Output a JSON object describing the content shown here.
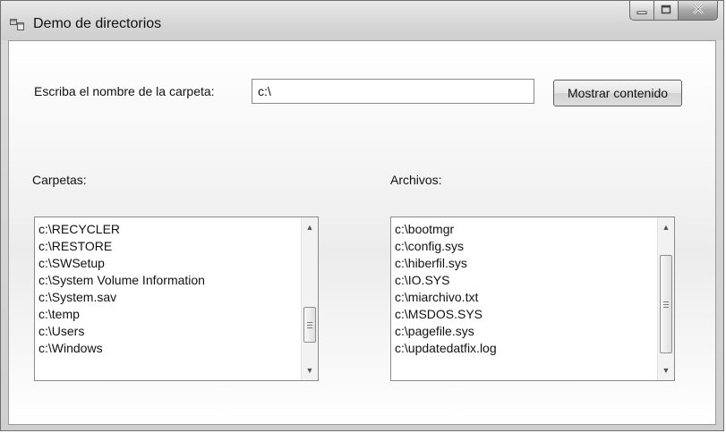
{
  "window": {
    "title": "Demo de directorios",
    "icons": {
      "app": "form-window-icon",
      "minimize": "minimize-icon",
      "maximize": "maximize-icon",
      "close": "close-icon"
    }
  },
  "form": {
    "folder_label": "Escriba el nombre de la carpeta:",
    "folder_value": "c:\\",
    "show_button": "Mostrar contenido"
  },
  "carpetas": {
    "label": "Carpetas:",
    "items": [
      "c:\\RECYCLER",
      "c:\\RESTORE",
      "c:\\SWSetup",
      "c:\\System Volume Information",
      "c:\\System.sav",
      "c:\\temp",
      "c:\\Users",
      "c:\\Windows"
    ]
  },
  "archivos": {
    "label": "Archivos:",
    "items": [
      "c:\\bootmgr",
      "c:\\config.sys",
      "c:\\hiberfil.sys",
      "c:\\IO.SYS",
      "c:\\miarchivo.txt",
      "c:\\MSDOS.SYS",
      "c:\\pagefile.sys",
      "c:\\updatedatfix.log"
    ]
  }
}
